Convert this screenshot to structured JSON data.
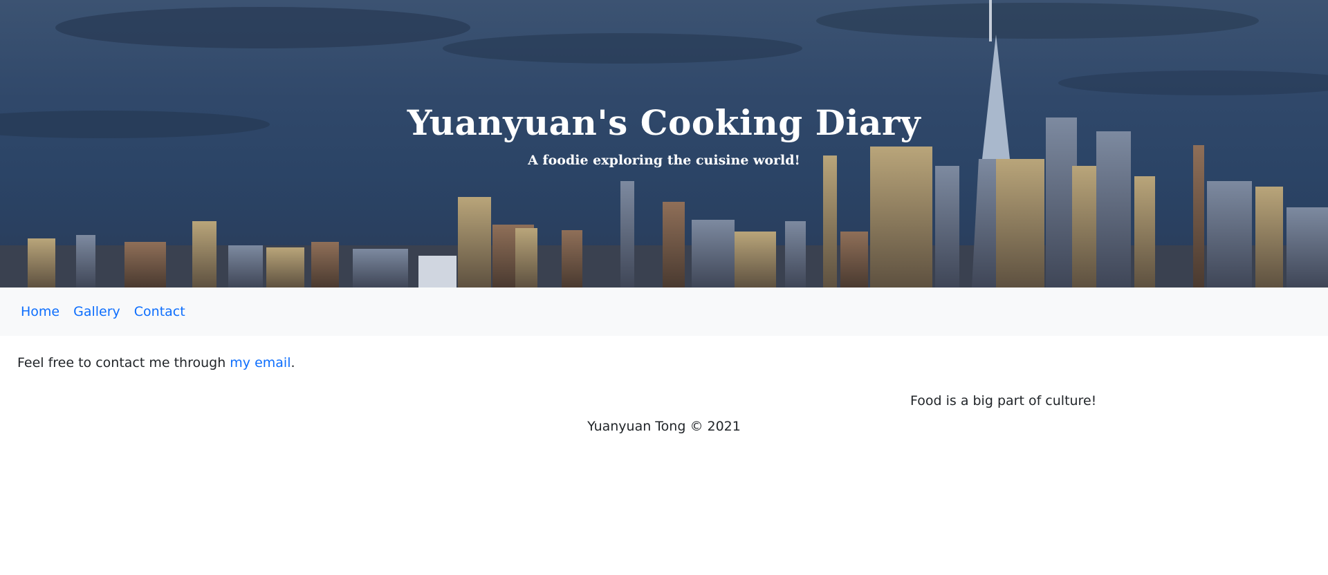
{
  "hero": {
    "title": "Yuanyuan's Cooking Diary",
    "subtitle": "A foodie exploring the cuisine world!"
  },
  "nav": {
    "items": [
      {
        "label": "Home"
      },
      {
        "label": "Gallery"
      },
      {
        "label": "Contact"
      }
    ]
  },
  "content": {
    "text_before": "Feel free to contact me through ",
    "link": "my email",
    "text_after": "."
  },
  "tagline": "Food is a big part of culture!",
  "footer": "Yuanyuan Tong © 2021",
  "colors": {
    "link": "#0d6efd",
    "navbar_bg": "#f8f9fa",
    "text": "#212529",
    "hero_sky": "#2f4668"
  }
}
